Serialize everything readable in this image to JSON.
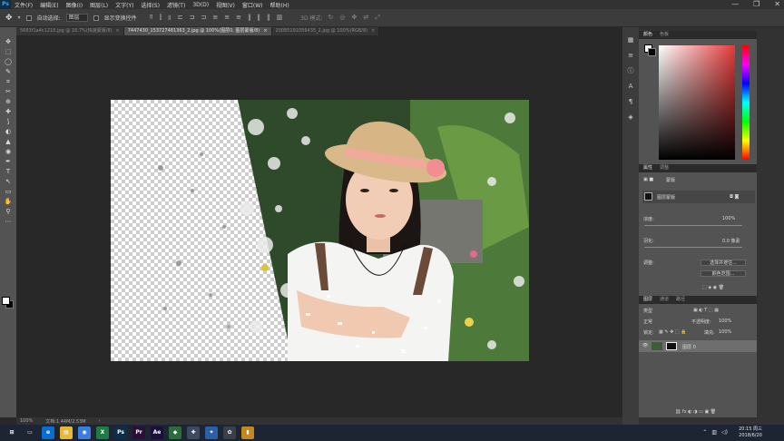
{
  "app": {
    "logo": "Ps"
  },
  "menu": [
    "文件(F)",
    "编辑(E)",
    "图像(I)",
    "图层(L)",
    "文字(Y)",
    "选择(S)",
    "滤镜(T)",
    "3D(D)",
    "视图(V)",
    "窗口(W)",
    "帮助(H)"
  ],
  "window_controls": {
    "minimize": "—",
    "restore": "❐",
    "close": "✕"
  },
  "options": {
    "auto_select_label": "自动选择:",
    "auto_select_value": "图层",
    "transform_label": "显示变换控件",
    "mode_label": "3D 模式:"
  },
  "tabs": [
    {
      "label": "5683f1a4c1216.jpg @ 16.7%(快速蒙版/8)",
      "active": false
    },
    {
      "label": "7447430_153727481363_2.jpg @ 100%(图层0, 图层蒙版/8)",
      "active": true
    },
    {
      "label": "20085191056435_2.jpg @ 100%(RGB/8)",
      "active": false
    }
  ],
  "toolbar": [
    "✥",
    "⬚",
    "◯",
    "✎",
    "⌗",
    "✂",
    "⊕",
    "✚",
    "⟆",
    "◐",
    "▲",
    "◉",
    "✒",
    "T",
    "↖",
    "▭",
    "✋",
    "⚲",
    "⋯"
  ],
  "status": {
    "zoom": "100%",
    "doc": "文档:1.44M/2.53M"
  },
  "side_strip": [
    "▦",
    "≡",
    "ⓘ",
    "A",
    "¶",
    "◈"
  ],
  "color_panel": {
    "tabs": [
      "颜色",
      "色板"
    ],
    "accent": "#e53a3a"
  },
  "properties_panel": {
    "tabs": [
      "属性",
      "调整"
    ],
    "header": "蒙版",
    "layer_mask_label": "图层蒙版",
    "density_label": "浓度:",
    "density_value": "100%",
    "feather_label": "羽化:",
    "feather_value": "0.0 像素",
    "adjust_label": "调整:",
    "select_subject_btn": "选择并遮住...",
    "color_range_btn": "颜色范围..."
  },
  "layers_panel": {
    "tabs": [
      "图层",
      "通道",
      "路径"
    ],
    "kind_label": "类型",
    "blend_mode": "正常",
    "opacity_label": "不透明度:",
    "opacity_value": "100%",
    "lock_label": "锁定:",
    "fill_label": "填充:",
    "fill_value": "100%",
    "layer_name": "图层 0"
  },
  "taskbar": {
    "icons": [
      {
        "name": "start-icon",
        "glyph": "⊞",
        "color": "#1d2432"
      },
      {
        "name": "task-view-icon",
        "glyph": "▭",
        "color": "#1d2432"
      },
      {
        "name": "edge-icon",
        "glyph": "e",
        "color": "#0a6ed1"
      },
      {
        "name": "folder-icon",
        "glyph": "▤",
        "color": "#e8b938"
      },
      {
        "name": "chrome-icon",
        "glyph": "◉",
        "color": "#3b7ddd"
      },
      {
        "name": "excel-icon",
        "glyph": "X",
        "color": "#1f7a43"
      },
      {
        "name": "photoshop-icon",
        "glyph": "Ps",
        "color": "#0b2e4a"
      },
      {
        "name": "premiere-icon",
        "glyph": "Pr",
        "color": "#2a0f3d"
      },
      {
        "name": "after-effects-icon",
        "glyph": "Ae",
        "color": "#1d0f3d"
      },
      {
        "name": "app-icon-1",
        "glyph": "◆",
        "color": "#2b6d3a"
      },
      {
        "name": "app-icon-2",
        "glyph": "✚",
        "color": "#3b4a5f"
      },
      {
        "name": "app-icon-3",
        "glyph": "✦",
        "color": "#2c5fa8"
      },
      {
        "name": "app-icon-4",
        "glyph": "✿",
        "color": "#3a3f4a"
      },
      {
        "name": "app-icon-5",
        "glyph": "▮",
        "color": "#c28a1e"
      }
    ],
    "time": "20:15 周三",
    "date": "2018/6/20"
  }
}
